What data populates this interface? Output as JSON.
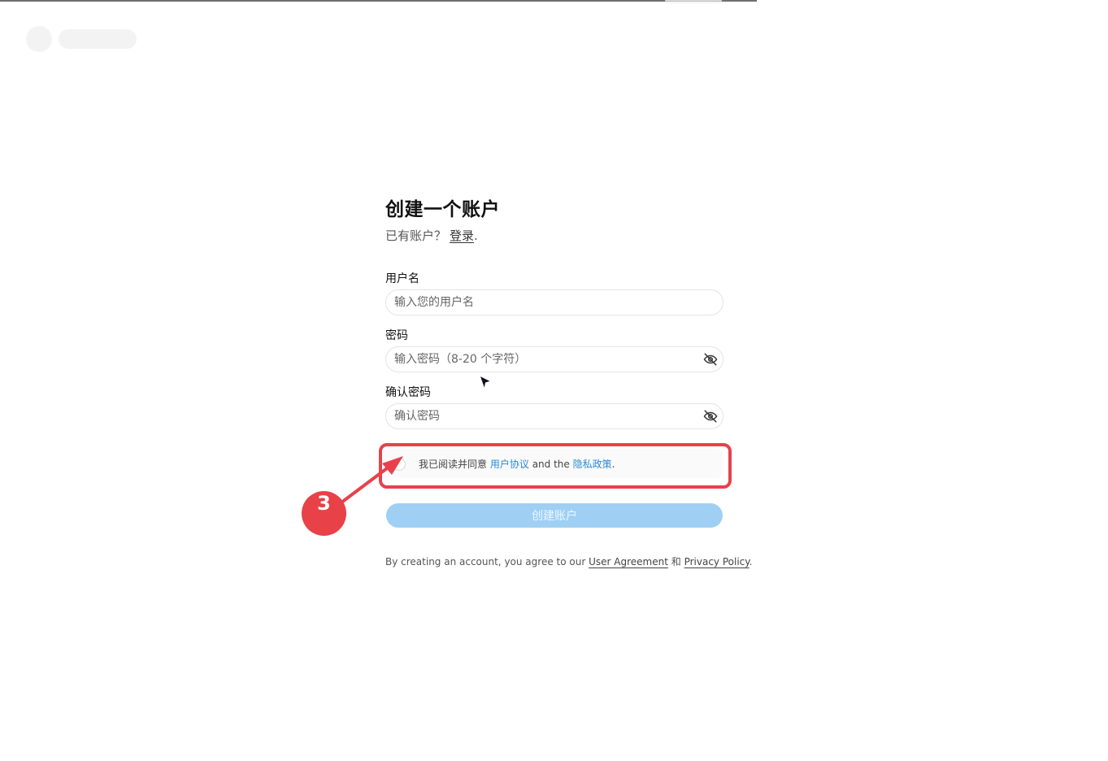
{
  "page": {
    "title": "创建一个账户",
    "have_account_text": "已有账户？",
    "login_link": "登录",
    "login_suffix": "."
  },
  "fields": {
    "username": {
      "label": "用户名",
      "placeholder": "输入您的用户名",
      "value": ""
    },
    "password": {
      "label": "密码",
      "placeholder": "输入密码（8-20 个字符）",
      "value": "",
      "toggle_icon": "eye-off-icon"
    },
    "confirm_password": {
      "label": "确认密码",
      "placeholder": "确认密码",
      "value": "",
      "toggle_icon": "eye-off-icon"
    }
  },
  "agreement": {
    "prefix": "我已阅读并同意",
    "user_agreement": "用户协议",
    "middle": "and the",
    "privacy_policy": "隐私政策",
    "suffix": ".",
    "checked": false
  },
  "submit": {
    "label": "创建账户",
    "enabled": false
  },
  "footer": {
    "prefix": "By creating an account, you agree to our",
    "user_agreement": "User Agreement",
    "and": "和",
    "privacy_policy": "Privacy Policy",
    "suffix": "."
  },
  "annotation": {
    "step_number": "3",
    "color": "#e8414b"
  },
  "colors": {
    "link_blue": "#2a8ad4",
    "button_disabled": "#9fd0f3"
  }
}
